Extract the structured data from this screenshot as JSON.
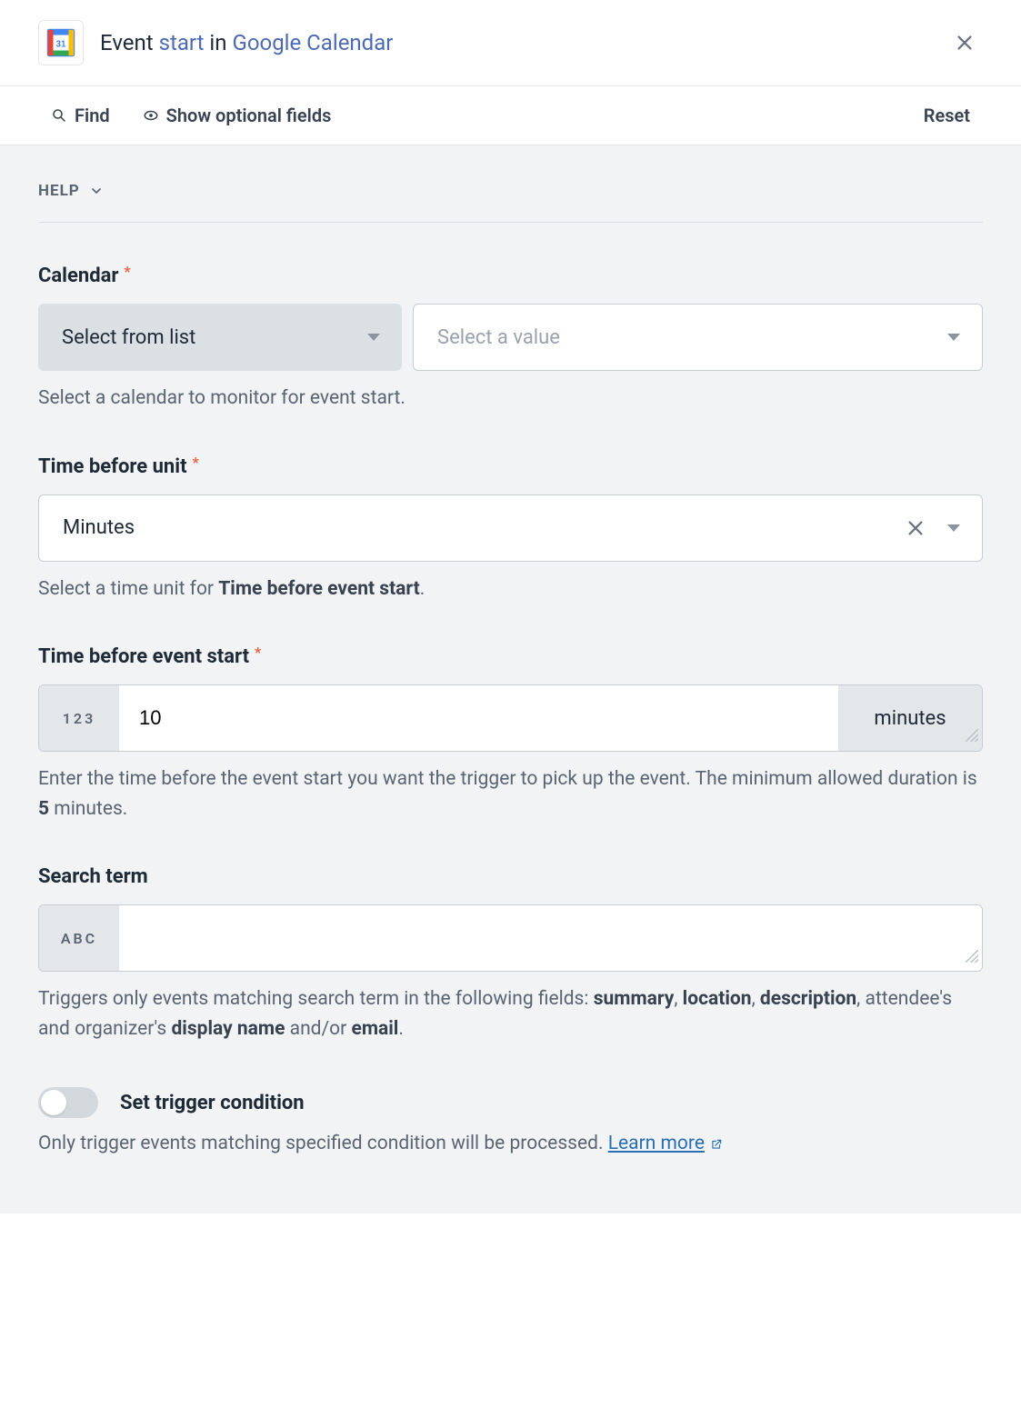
{
  "header": {
    "title_prefix": "Event ",
    "title_link1": "start",
    "title_mid": " in ",
    "title_link2": "Google Calendar"
  },
  "toolbar": {
    "find": "Find",
    "optional": "Show optional fields",
    "reset": "Reset"
  },
  "help": {
    "label": "HELP"
  },
  "fields": {
    "calendar": {
      "label": "Calendar",
      "selector_label": "Select from list",
      "value_placeholder": "Select a value",
      "helper": "Select a calendar to monitor for event start."
    },
    "time_unit": {
      "label": "Time before unit",
      "value": "Minutes",
      "helper_pre": "Select a time unit for ",
      "helper_bold": "Time before event start",
      "helper_post": "."
    },
    "time_before": {
      "label": "Time before event start",
      "prefix": "123",
      "value": "10",
      "suffix": "minutes",
      "helper_pre": "Enter the time before the event start you want the trigger to pick up the event. The minimum allowed duration is ",
      "helper_bold": "5",
      "helper_post": " minutes."
    },
    "search": {
      "label": "Search term",
      "prefix": "ABC",
      "value": "",
      "helper_p1": "Triggers only events matching search term in the following fields: ",
      "b1": "summary",
      "c1": ", ",
      "b2": "location",
      "c2": ", ",
      "b3": "description",
      "c3": ", attendee's and organizer's ",
      "b4": "display name",
      "c4": " and/or ",
      "b5": "email",
      "c5": "."
    },
    "trigger_cond": {
      "label": "Set trigger condition",
      "helper": "Only trigger events matching specified condition will be processed. ",
      "learn_more": "Learn more"
    }
  }
}
